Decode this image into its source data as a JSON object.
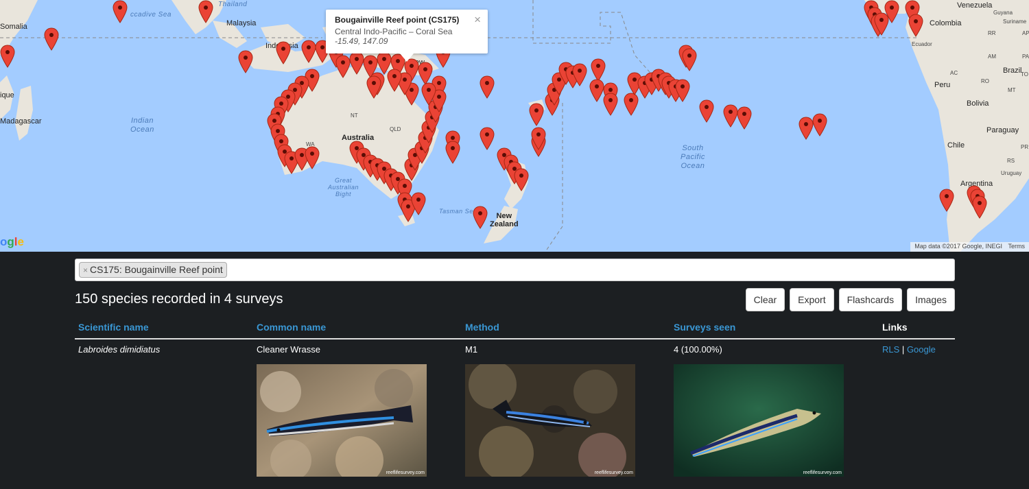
{
  "map": {
    "labels": {
      "somalia": "Somalia",
      "madagascar": "Madagascar",
      "mozambique": "ique",
      "indian_ocean": "Indian\nOcean",
      "malaysia": "Malaysia",
      "thailand": "Thailand",
      "andaman_sea": "ccadive Sea",
      "indonesia": "Indonesia",
      "new_guinea": "New",
      "australia": "Australia",
      "nt": "NT",
      "qld": "QLD",
      "wa": "WA",
      "great_australian_bight": "Great\nAustralian\nBight",
      "tasman_sea": "Tasman Sea",
      "new_zealand": "New\nZealand",
      "south_pacific": "South\nPacific\nOcean",
      "venezuela": "Venezuela",
      "guyana": "Guyana",
      "suriname": "Suriname",
      "colombia": "Colombia",
      "ecuador": "Ecuador",
      "peru": "Peru",
      "brazil": "Brazil",
      "bolivia": "Bolivia",
      "paraguay": "Paraguay",
      "chile": "Chile",
      "argentina": "Argentina",
      "uruguay": "Uruguay",
      "rr": "RR",
      "ap": "AP",
      "am": "AM",
      "pa": "PA",
      "ac": "AC",
      "ro": "RO",
      "mt": "MT",
      "to": "TO",
      "pr": "PR",
      "rs": "RS"
    },
    "infowindow": {
      "title": "Bougainville Reef point (CS175)",
      "subtitle": "Central Indo-Pacific – Coral Sea",
      "coords": "-15.49, 147.09",
      "close": "×"
    },
    "logo": "ogle",
    "attribution": "Map data ©2017 Google, INEGI",
    "terms": "Terms"
  },
  "search": {
    "tag_label": "CS175: Bougainville Reef point",
    "tag_remove": "×"
  },
  "summary": "150 species recorded in 4 surveys",
  "buttons": {
    "clear": "Clear",
    "export": "Export",
    "flashcards": "Flashcards",
    "images": "Images"
  },
  "table": {
    "headers": {
      "scientific": "Scientific name",
      "common": "Common name",
      "method": "Method",
      "surveys": "Surveys seen",
      "links": "Links"
    },
    "rows": [
      {
        "scientific": "Labroides dimidiatus",
        "common": "Cleaner Wrasse",
        "method": "M1",
        "surveys": "4 (100.00%)",
        "link_rls": "RLS",
        "link_sep": "|",
        "link_google": "Google",
        "photo_credit": "reeflifesurvey.com"
      }
    ]
  },
  "colors": {
    "ocean": "#a3ccff",
    "land": "#e9e5dc",
    "pin": "#ea4335",
    "accent_link": "#3a97d4",
    "background": "#1c1f22"
  }
}
